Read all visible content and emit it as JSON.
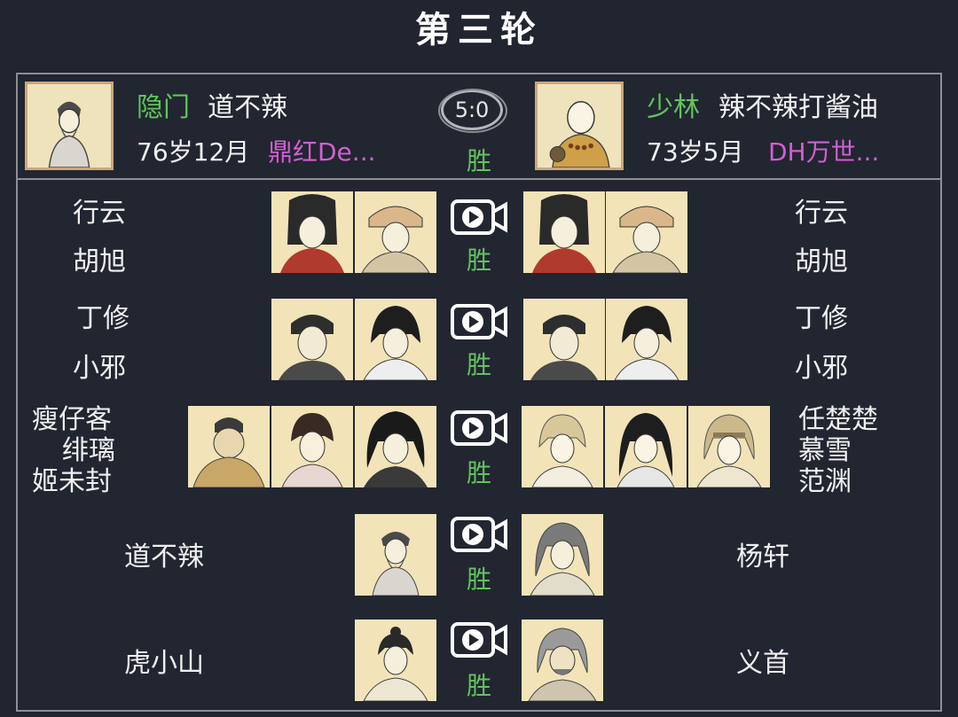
{
  "round_title": "第三轮",
  "header": {
    "left": {
      "sect": "隐门",
      "player": "道不辣",
      "age": "76岁12月",
      "server": "鼎红De...",
      "avatar": "old-sage-avatar"
    },
    "right": {
      "sect": "少林",
      "player": "辣不辣打酱油",
      "age": "73岁5月",
      "server": "DH万世...",
      "avatar": "monk-avatar"
    },
    "score": "5:0",
    "result": "胜"
  },
  "matches": [
    {
      "left_names": [
        "行云",
        "胡旭"
      ],
      "right_names": [
        "行云",
        "胡旭"
      ],
      "result": "胜"
    },
    {
      "left_names": [
        "丁修",
        "小邪"
      ],
      "right_names": [
        "丁修",
        "小邪"
      ],
      "result": "胜"
    },
    {
      "left_names": [
        "瘦仔客",
        "绯璃",
        "姬未封"
      ],
      "right_names": [
        "任楚楚",
        "慕雪",
        "范渊"
      ],
      "result": "胜"
    },
    {
      "left_names": [
        "道不辣"
      ],
      "right_names": [
        "杨轩"
      ],
      "result": "胜"
    },
    {
      "left_names": [
        "虎小山"
      ],
      "right_names": [
        "义首"
      ],
      "result": "胜"
    }
  ],
  "colors": {
    "background": "#212530",
    "border": "#8c8f96",
    "win_green": "#62c35e",
    "server_purple": "#d25fd0",
    "portrait_bg": "#f2e4b8"
  }
}
